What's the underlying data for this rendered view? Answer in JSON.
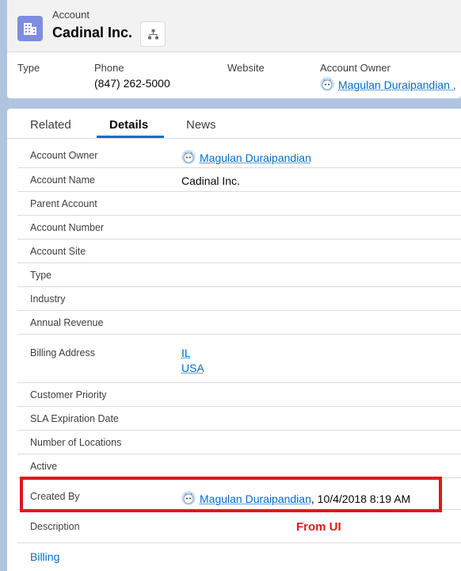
{
  "header": {
    "object_type": "Account",
    "record_name": "Cadinal Inc.",
    "highlights": [
      {
        "label": "Type",
        "value": ""
      },
      {
        "label": "Phone",
        "value": "(847) 262-5000"
      },
      {
        "label": "Website",
        "value": ""
      },
      {
        "label": "Account Owner",
        "value": "Magulan Duraipandian ,"
      }
    ]
  },
  "tabs": [
    "Related",
    "Details",
    "News"
  ],
  "active_tab": "Details",
  "fields": {
    "account_owner": {
      "label": "Account Owner",
      "value": "Magulan Duraipandian"
    },
    "account_name": {
      "label": "Account Name",
      "value": "Cadinal Inc."
    },
    "parent_account": {
      "label": "Parent Account",
      "value": ""
    },
    "account_number": {
      "label": "Account Number",
      "value": ""
    },
    "account_site": {
      "label": "Account Site",
      "value": ""
    },
    "type": {
      "label": "Type",
      "value": ""
    },
    "industry": {
      "label": "Industry",
      "value": ""
    },
    "annual_revenue": {
      "label": "Annual Revenue",
      "value": ""
    },
    "billing_address": {
      "label": "Billing Address",
      "line1": "IL",
      "line2": "USA"
    },
    "customer_priority": {
      "label": "Customer Priority",
      "value": ""
    },
    "sla_expiration_date": {
      "label": "SLA Expiration Date",
      "value": ""
    },
    "number_of_locations": {
      "label": "Number of Locations",
      "value": ""
    },
    "active": {
      "label": "Active",
      "value": ""
    },
    "created_by": {
      "label": "Created By",
      "user": "Magulan Duraipandian",
      "datetime": ", 10/4/2018 8:19 AM"
    },
    "description": {
      "label": "Description",
      "value": ""
    }
  },
  "annotation": "From UI",
  "section_billing": "Billing",
  "colors": {
    "brand": "#0070d2",
    "link": "#006dcc",
    "highlight": "#e3161e",
    "account_icon": "#7f8de1"
  },
  "icons": {
    "object": "account-building-icon",
    "hierarchy": "hierarchy-icon",
    "avatar": "user-avatar-icon"
  }
}
